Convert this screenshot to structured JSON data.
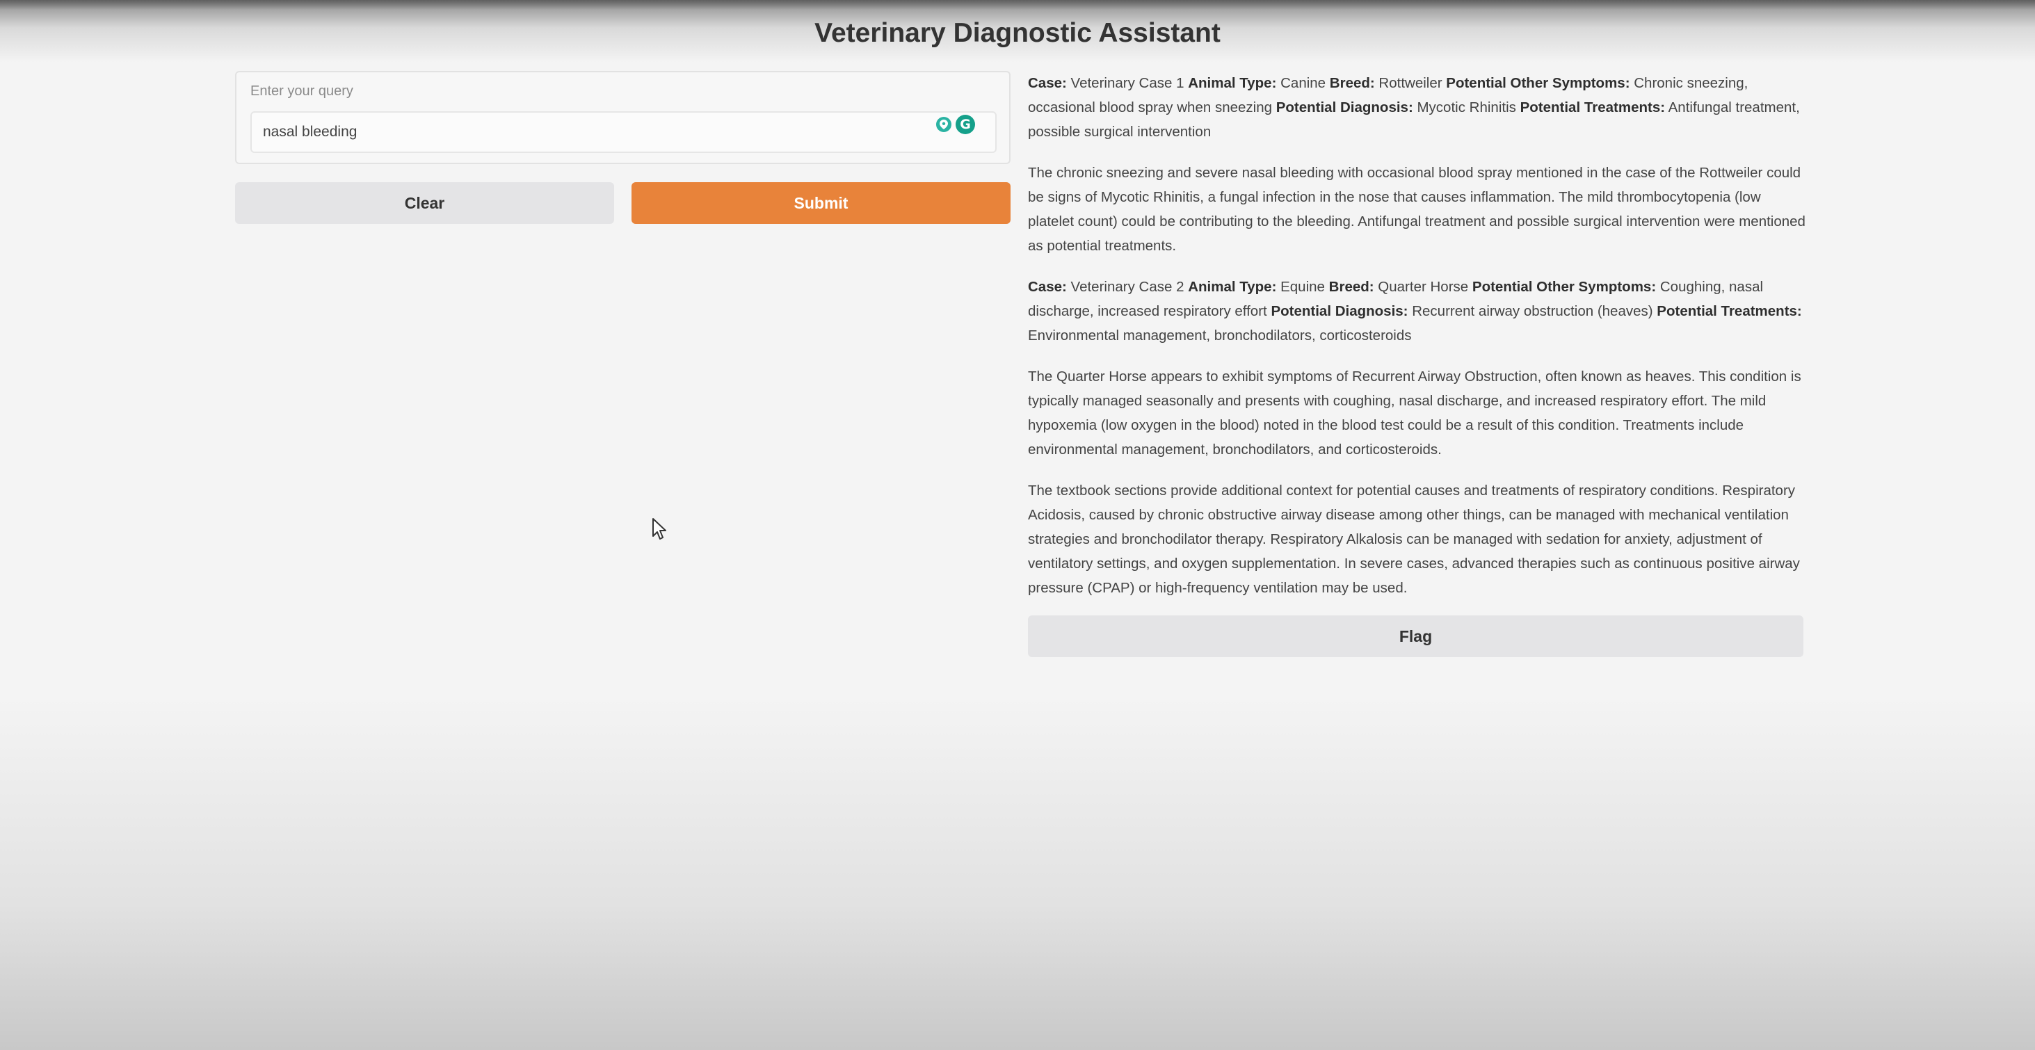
{
  "app": {
    "title": "Veterinary Diagnostic Assistant"
  },
  "query": {
    "label": "Enter your query",
    "value": "nasal bleeding"
  },
  "buttons": {
    "clear": "Clear",
    "submit": "Submit",
    "flag": "Flag"
  },
  "colors": {
    "accent": "#e8833a",
    "neutral_button": "#e4e4e6"
  },
  "output": {
    "cases": [
      {
        "case_label": "Case:",
        "case_value": "Veterinary Case 1",
        "animal_label": "Animal Type:",
        "animal_value": "Canine",
        "breed_label": "Breed:",
        "breed_value": "Rottweiler",
        "symptoms_label": "Potential Other Symptoms:",
        "symptoms_value": "Chronic sneezing, occasional blood spray when sneezing",
        "diagnosis_label": "Potential Diagnosis:",
        "diagnosis_value": "Mycotic Rhinitis",
        "treatments_label": "Potential Treatments:",
        "treatments_value": "Antifungal treatment, possible surgical intervention"
      },
      {
        "case_label": "Case:",
        "case_value": "Veterinary Case 2",
        "animal_label": "Animal Type:",
        "animal_value": "Equine",
        "breed_label": "Breed:",
        "breed_value": "Quarter Horse",
        "symptoms_label": "Potential Other Symptoms:",
        "symptoms_value": "Coughing, nasal discharge, increased respiratory effort",
        "diagnosis_label": "Potential Diagnosis:",
        "diagnosis_value": "Recurrent airway obstruction (heaves)",
        "treatments_label": "Potential Treatments:",
        "treatments_value": "Environmental management, bronchodilators, corticosteroids"
      }
    ],
    "analysis_1": "The chronic sneezing and severe nasal bleeding with occasional blood spray mentioned in the case of the Rottweiler could be signs of Mycotic Rhinitis, a fungal infection in the nose that causes inflammation. The mild thrombocytopenia (low platelet count) could be contributing to the bleeding. Antifungal treatment and possible surgical intervention were mentioned as potential treatments.",
    "analysis_2": "The Quarter Horse appears to exhibit symptoms of Recurrent Airway Obstruction, often known as heaves. This condition is typically managed seasonally and presents with coughing, nasal discharge, and increased respiratory effort. The mild hypoxemia (low oxygen in the blood) noted in the blood test could be a result of this condition. Treatments include environmental management, bronchodilators, and corticosteroids.",
    "textbook_note": "The textbook sections provide additional context for potential causes and treatments of respiratory conditions. Respiratory Acidosis, caused by chronic obstructive airway disease among other things, can be managed with mechanical ventilation strategies and bronchodilator therapy. Respiratory Alkalosis can be managed with sedation for anxiety, adjustment of ventilatory settings, and oxygen supplementation. In severe cases, advanced therapies such as continuous positive airway pressure (CPAP) or high-frequency ventilation may be used."
  }
}
